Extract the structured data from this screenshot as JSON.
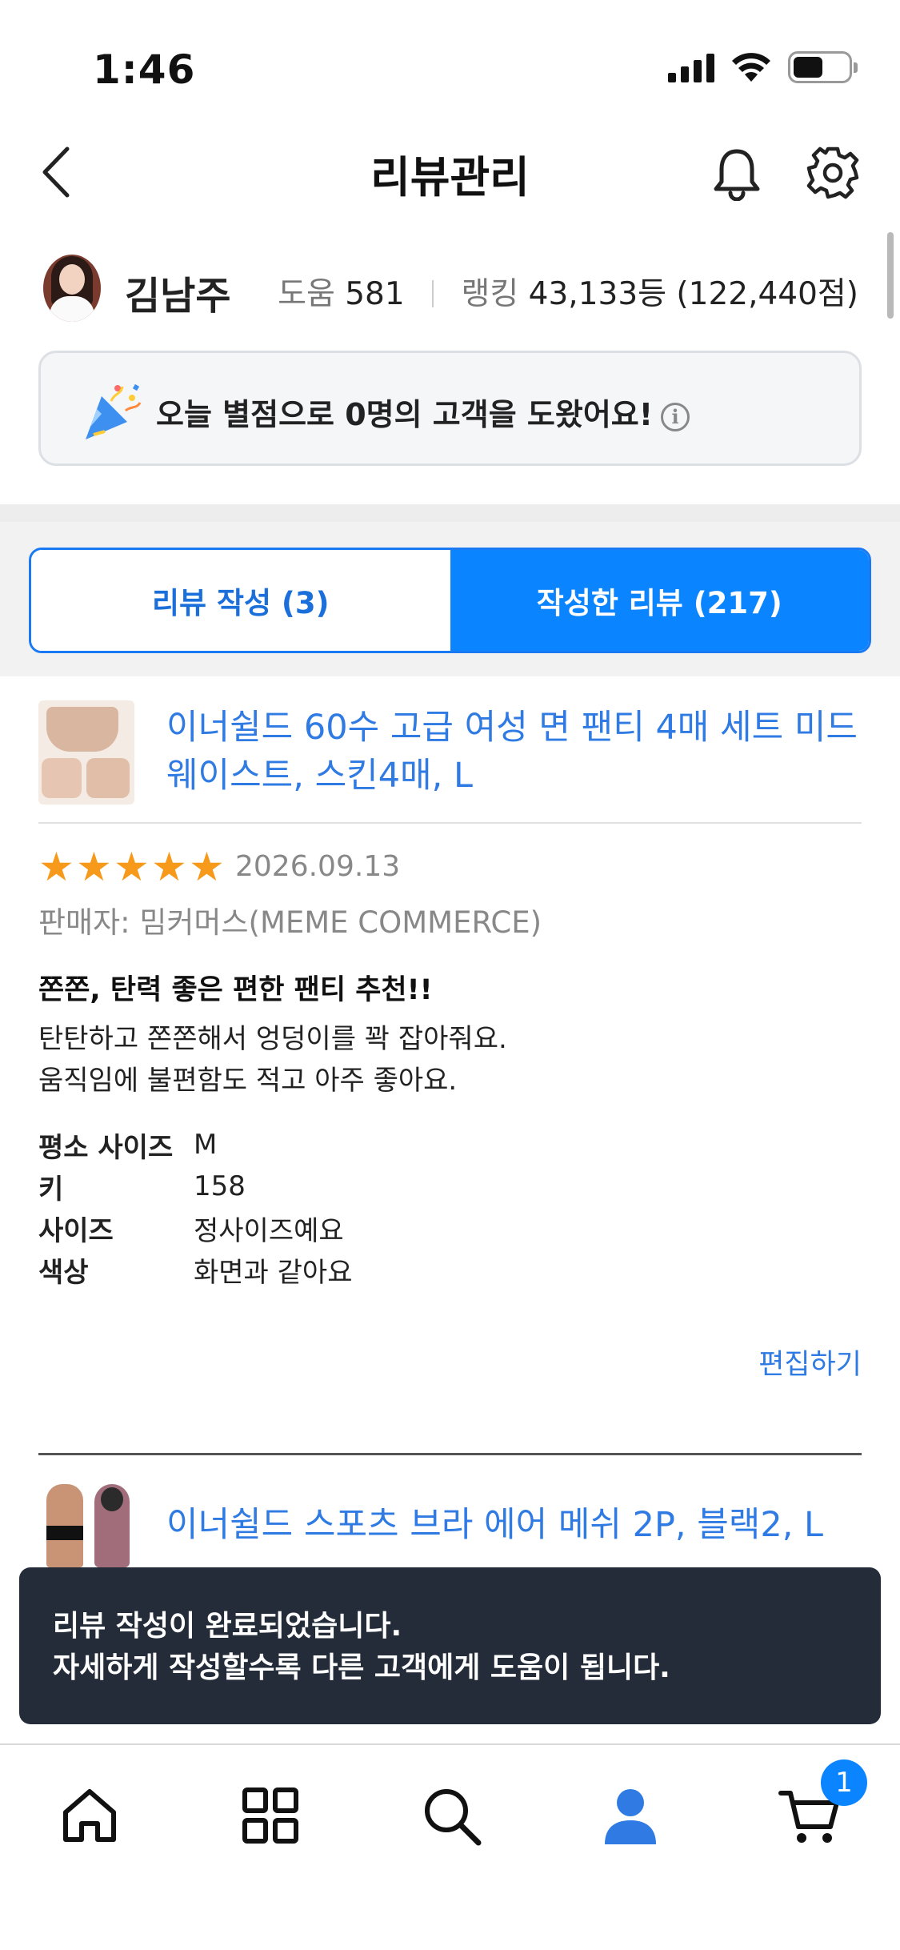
{
  "status_bar": {
    "time": "1:46"
  },
  "header": {
    "title": "리뷰관리"
  },
  "profile": {
    "name": "김남주",
    "help_label": "도움",
    "help_count": "581",
    "rank_label": "랭킹",
    "rank_value": "43,133등 (122,440점)"
  },
  "banner": {
    "text": "오늘 별점으로 0명의 고객을 도왔어요!"
  },
  "tabs": [
    {
      "label": "리뷰 작성 (3)",
      "active": false
    },
    {
      "label": "작성한 리뷰 (217)",
      "active": true
    }
  ],
  "reviews": [
    {
      "product_title": "이너쉴드 60수 고급 여성 면 팬티 4매 세트 미드웨이스트, 스킨4매, L",
      "rating": 5,
      "date": "2026.09.13",
      "seller": "판매자: 밈커머스(MEME COMMERCE)",
      "headline": "쫀쫀, 탄력 좋은 편한 팬티 추천!!",
      "body_line1": "탄탄하고 쫀쫀해서 엉덩이를 꽉 잡아줘요.",
      "body_line2": "움직임에 불편함도 적고 아주 좋아요.",
      "attributes": [
        {
          "key": "평소 사이즈",
          "value": "M"
        },
        {
          "key": "키",
          "value": "158"
        },
        {
          "key": "사이즈",
          "value": "정사이즈예요"
        },
        {
          "key": "색상",
          "value": "화면과 같아요"
        }
      ],
      "edit_label": "편집하기"
    },
    {
      "product_title": "이너쉴드 스포츠 브라 에어 메쉬 2P, 블랙2, L"
    }
  ],
  "toast": {
    "line1": "리뷰 작성이 완료되었습니다.",
    "line2": "자세하게 작성할수록 다른 고객에게 도움이 됩니다."
  },
  "bottom_nav": {
    "items": [
      "home-icon",
      "grid-icon",
      "search-icon",
      "user-icon",
      "cart-icon"
    ],
    "active": "user-icon",
    "cart_badge": "1"
  },
  "colors": {
    "accent": "#0a84ff",
    "link": "#2f7be3",
    "star": "#f79a1c",
    "toast_bg": "#232c38"
  }
}
